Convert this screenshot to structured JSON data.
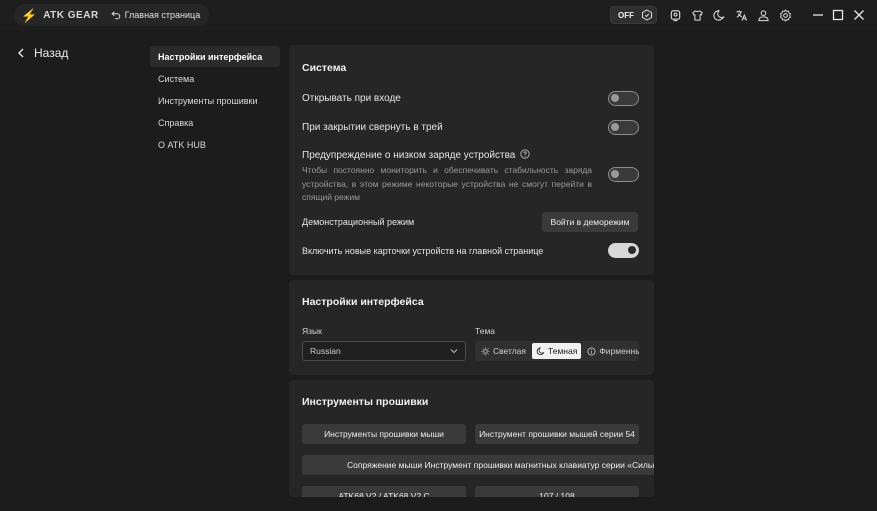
{
  "titlebar": {
    "app_name": "ATK GEAR",
    "home_link": "Главная страница",
    "off_label": "OFF"
  },
  "back_label": "Назад",
  "nav": {
    "items": [
      {
        "label": "Настройки интерфейса",
        "active": true
      },
      {
        "label": "Система",
        "active": false
      },
      {
        "label": "Инструменты прошивки",
        "active": false
      },
      {
        "label": "Справка",
        "active": false
      },
      {
        "label": "О ATK HUB",
        "active": false
      }
    ]
  },
  "system": {
    "title": "Система",
    "open_on_login": {
      "label": "Открывать при входе",
      "enabled": false
    },
    "minimize_to_tray": {
      "label": "При закрытии свернуть в трей",
      "enabled": false
    },
    "low_battery": {
      "label": "Предупреждение о низком заряде устройства",
      "description": "Чтобы постоянно мониторить и обеспечивать стабильность заряда устройства, в этом режиме некоторые устройства не смогут перейти в спящий режим",
      "enabled": false
    },
    "demo_mode": {
      "label": "Демонстрационный режим",
      "button": "Войти в деморежим"
    },
    "new_cards": {
      "label": "Включить новые карточки устройств на главной странице",
      "enabled": true
    }
  },
  "interface": {
    "title": "Настройки интерфейса",
    "language_label": "Язык",
    "language_value": "Russian",
    "theme_label": "Тема",
    "theme_options": [
      "Светлая",
      "Темная",
      "Фирменный"
    ],
    "theme_selected": "Темная"
  },
  "firmware": {
    "title": "Инструменты прошивки",
    "buttons": [
      "Инструменты прошивки мыши",
      "Инструмент прошивки мышей серии 54",
      "Сопряжение мыши Инструмент прошивки магнитных клавиатур серии «Сильн",
      "ATK68 V2 / ATK68 V2 C",
      "107 / 108"
    ]
  },
  "colors": {
    "background": "#1c1c1c",
    "panel": "#262626",
    "accent_logo": "#ff6a2e"
  }
}
